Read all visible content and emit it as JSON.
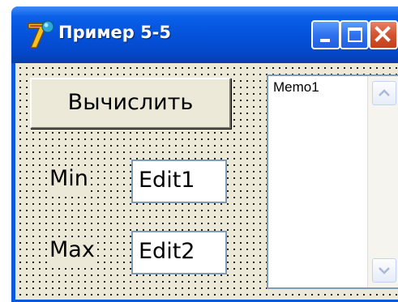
{
  "window": {
    "title": "Пример 5-5",
    "title_bar_color": "#0451d8",
    "controls": {
      "minimize_icon": "minimize-icon",
      "maximize_icon": "maximize-icon",
      "close_icon": "close-icon"
    }
  },
  "form": {
    "background_color": "#ece9d8",
    "design_grid": true,
    "calc_button_label": "Вычислить",
    "min_label": "Min",
    "max_label": "Max",
    "edit1_value": "Edit1",
    "edit2_value": "Edit2",
    "memo_text": "Memo1",
    "memo_scrollbar": {
      "up_icon": "chevron-up-icon",
      "down_icon": "chevron-down-icon"
    }
  }
}
